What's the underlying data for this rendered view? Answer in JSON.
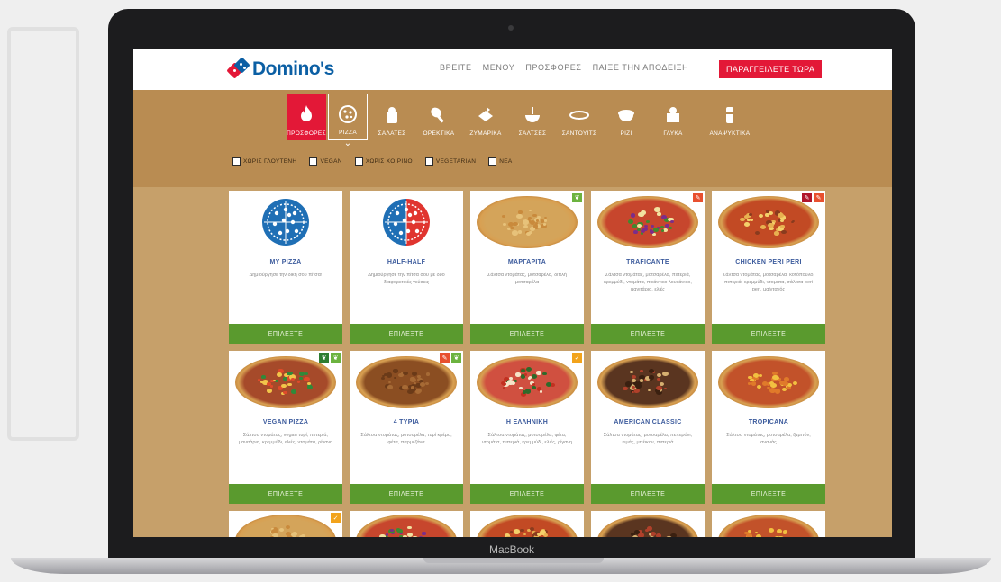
{
  "device": {
    "brand_label": "MacBook"
  },
  "header": {
    "logo_text": "Domino's",
    "nav": [
      "ΒΡΕΙΤΕ",
      "ΜΕΝΟΥ",
      "ΠΡΟΣΦΟΡΕΣ",
      "ΠΑΙΞΕ ΤΗΝ ΑΠΟΔΕΙΞΗ"
    ],
    "order_button": "ΠΑΡΑΓΓΕΙΛΕΤΕ ΤΩΡΑ"
  },
  "categories": [
    {
      "label": "ΠΡΟΣΦΟΡΕΣ",
      "icon": "fire-icon",
      "state": "offers"
    },
    {
      "label": "PIZZA",
      "icon": "pizza-icon",
      "state": "active"
    },
    {
      "label": "ΣΑΛΑΤΕΣ",
      "icon": "salad-icon",
      "state": ""
    },
    {
      "label": "ΟΡΕΚΤΙΚΑ",
      "icon": "drumstick-icon",
      "state": ""
    },
    {
      "label": "ΖΥΜΑΡΙΚΑ",
      "icon": "pasta-icon",
      "state": ""
    },
    {
      "label": "ΣΑΛΤΣΕΣ",
      "icon": "dip-bowl-icon",
      "state": ""
    },
    {
      "label": "ΣΑΝΤΟΥΙΤΣ",
      "icon": "sandwich-icon",
      "state": ""
    },
    {
      "label": "ΡΙΖΙ",
      "icon": "rice-bowl-icon",
      "state": ""
    },
    {
      "label": "ΓΛΥΚΑ",
      "icon": "dessert-icon",
      "state": ""
    },
    {
      "label": "ΑΝΑΨΥΚΤΙΚΑ",
      "icon": "drink-icon",
      "state": ""
    }
  ],
  "filters": [
    {
      "label": "ΧΩΡΙΣ ΓΛΟΥΤΕΝΗ"
    },
    {
      "label": "VEGAN"
    },
    {
      "label": "ΧΩΡΙΣ ΧΟΙΡΙΝΟ"
    },
    {
      "label": "VEGETARIAN"
    },
    {
      "label": "ΝΕΑ"
    }
  ],
  "products": [
    {
      "name": "MY PIZZA",
      "desc": "Δημιούργησε την δική σου πίτσα!",
      "visual": "icon-blue",
      "badges": []
    },
    {
      "name": "HALF-HALF",
      "desc": "Δημιούργησε την πίτσα σου με δύο διαφορετικές γεύσεις",
      "visual": "icon-half",
      "badges": []
    },
    {
      "name": "ΜΑΡΓΑΡΙΤΑ",
      "desc": "Σάλτσα ντομάτας, μοτσαρέλα, διπλή μοτσαρέλα",
      "visual": "margherita",
      "badges": [
        "green"
      ]
    },
    {
      "name": "TRAFICANTE",
      "desc": "Σάλτσα ντομάτας, μοτσαρέλα, πιπεριά, κρεμμύδι, ντομάτα, πικάντικο λουκάνικο, μανιτάρια, ελιές",
      "visual": "traficante",
      "badges": [
        "red"
      ]
    },
    {
      "name": "CHICKEN PERI PERI",
      "desc": "Σάλτσα ντομάτας, μοτσαρέλα, κοτόπουλο, πιπεριά, κρεμμύδι, ντομάτα, σάλτσα peri peri, μαϊντανός",
      "visual": "periperi",
      "badges": [
        "darkred",
        "red"
      ]
    },
    {
      "name": "VEGAN PIZZA",
      "desc": "Σάλτσα ντομάτας, vegan τυρί, πιπεριά, μανιτάρια, κρεμμύδι, ελιές, ντομάτα, ρίγανη",
      "visual": "vegan",
      "badges": [
        "darkgreen",
        "green"
      ]
    },
    {
      "name": "4 ΤΥΡΙΑ",
      "desc": "Σάλτσα ντομάτας, μοτσαρέλα, τυρί κρέμα, φέτα, παρμεζάνα",
      "visual": "fourcheese",
      "badges": [
        "red",
        "green"
      ]
    },
    {
      "name": "Η ΕΛΛΗΝΙΚΗ",
      "desc": "Σάλτσα ντομάτας, μοτσαρέλα, φέτα, ντομάτα, πιπεριά, κρεμμύδι, ελιές, ρίγανη",
      "visual": "greek",
      "badges": [
        "orange"
      ]
    },
    {
      "name": "AMERICAN CLASSIC",
      "desc": "Σάλτσα ντομάτας, μοτσαρέλα, πεπερόνι, κιμάς, μπέικον, πιπεριά",
      "visual": "american",
      "badges": []
    },
    {
      "name": "TROPICANA",
      "desc": "Σάλτσα ντομάτας, μοτσαρέλα, ζαμπόν, ανανάς",
      "visual": "tropicana",
      "badges": []
    }
  ],
  "select_label": "ΕΠΙΛΕΞΤΕ",
  "partial_row": [
    {
      "badges": [
        "orange"
      ]
    },
    {
      "badges": []
    },
    {
      "badges": []
    },
    {
      "badges": []
    },
    {
      "badges": []
    }
  ],
  "colors": {
    "brand_blue": "#0b5fa4",
    "brand_red": "#e31837",
    "select_green": "#5a9a2e",
    "page_brown": "#c6a06a"
  }
}
